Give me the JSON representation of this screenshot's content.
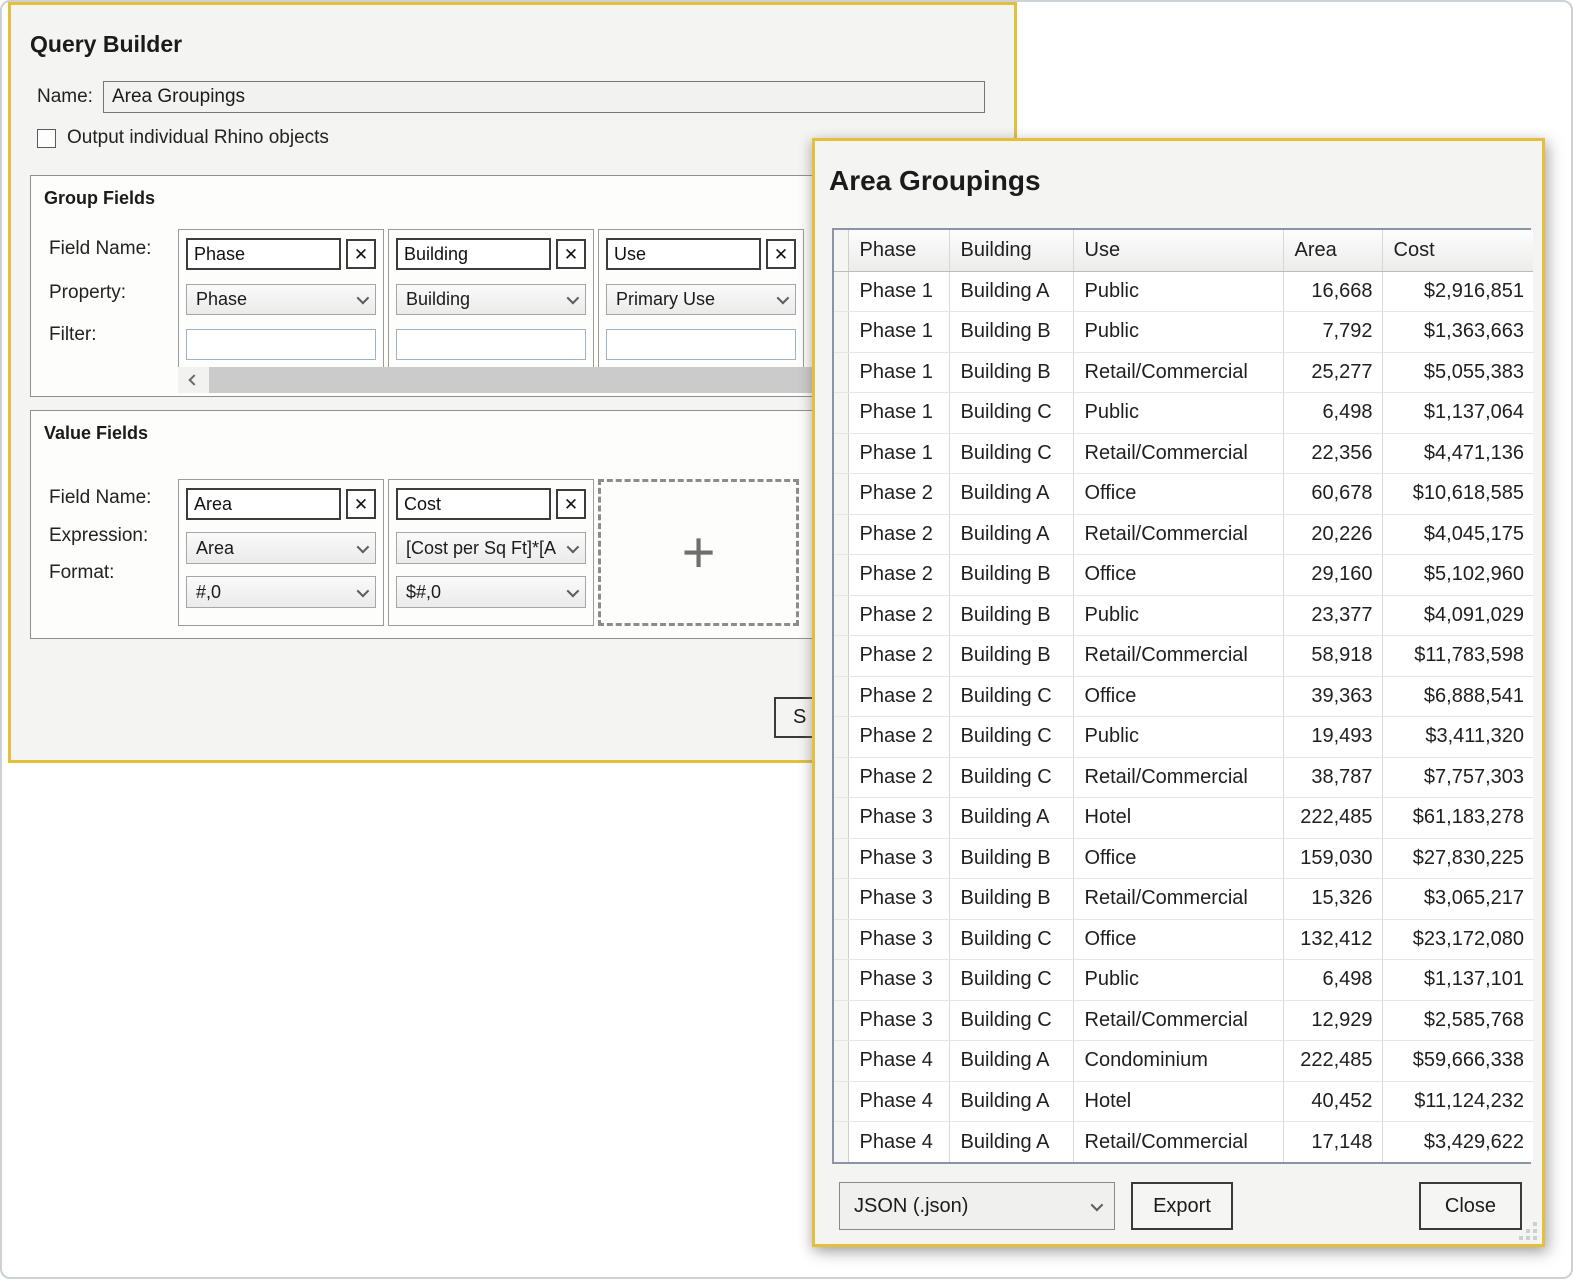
{
  "colors": {
    "window_border": "#e4bf39",
    "window_bg": "#f4f4f2",
    "table_outer_border": "#8696a5"
  },
  "icons": {
    "remove_field": "✕",
    "add_field": "+",
    "chevron_down": "⌄",
    "chevron_left": "‹",
    "resize_grip": "⋰"
  },
  "query_builder": {
    "title": "Query Builder",
    "name_label": "Name:",
    "name_value": "Area Groupings",
    "checkbox_label": "Output individual Rhino objects",
    "checkbox_checked": false,
    "group_fields": {
      "title": "Group Fields",
      "row_labels": [
        "Field Name:",
        "Property:",
        "Filter:"
      ],
      "fields": [
        {
          "name": "Phase",
          "property": "Phase",
          "filter": ""
        },
        {
          "name": "Building",
          "property": "Building",
          "filter": ""
        },
        {
          "name": "Use",
          "property": "Primary Use",
          "filter": ""
        }
      ]
    },
    "value_fields": {
      "title": "Value Fields",
      "row_labels": [
        "Field Name:",
        "Expression:",
        "Format:"
      ],
      "fields": [
        {
          "name": "Area",
          "expression": "Area",
          "format": "#,0"
        },
        {
          "name": "Cost",
          "expression": "[Cost per Sq Ft]*[A",
          "format": "$#,0"
        }
      ]
    },
    "partial_button_label": "S"
  },
  "results_window": {
    "title": "Area Groupings",
    "table": {
      "columns": [
        "Phase",
        "Building",
        "Use",
        "Area",
        "Cost"
      ],
      "rows": [
        [
          "Phase 1",
          "Building A",
          "Public",
          "16,668",
          "$2,916,851"
        ],
        [
          "Phase 1",
          "Building B",
          "Public",
          "7,792",
          "$1,363,663"
        ],
        [
          "Phase 1",
          "Building B",
          "Retail/Commercial",
          "25,277",
          "$5,055,383"
        ],
        [
          "Phase 1",
          "Building C",
          "Public",
          "6,498",
          "$1,137,064"
        ],
        [
          "Phase 1",
          "Building C",
          "Retail/Commercial",
          "22,356",
          "$4,471,136"
        ],
        [
          "Phase 2",
          "Building A",
          "Office",
          "60,678",
          "$10,618,585"
        ],
        [
          "Phase 2",
          "Building A",
          "Retail/Commercial",
          "20,226",
          "$4,045,175"
        ],
        [
          "Phase 2",
          "Building B",
          "Office",
          "29,160",
          "$5,102,960"
        ],
        [
          "Phase 2",
          "Building B",
          "Public",
          "23,377",
          "$4,091,029"
        ],
        [
          "Phase 2",
          "Building B",
          "Retail/Commercial",
          "58,918",
          "$11,783,598"
        ],
        [
          "Phase 2",
          "Building C",
          "Office",
          "39,363",
          "$6,888,541"
        ],
        [
          "Phase 2",
          "Building C",
          "Public",
          "19,493",
          "$3,411,320"
        ],
        [
          "Phase 2",
          "Building C",
          "Retail/Commercial",
          "38,787",
          "$7,757,303"
        ],
        [
          "Phase 3",
          "Building A",
          "Hotel",
          "222,485",
          "$61,183,278"
        ],
        [
          "Phase 3",
          "Building B",
          "Office",
          "159,030",
          "$27,830,225"
        ],
        [
          "Phase 3",
          "Building B",
          "Retail/Commercial",
          "15,326",
          "$3,065,217"
        ],
        [
          "Phase 3",
          "Building C",
          "Office",
          "132,412",
          "$23,172,080"
        ],
        [
          "Phase 3",
          "Building C",
          "Public",
          "6,498",
          "$1,137,101"
        ],
        [
          "Phase 3",
          "Building C",
          "Retail/Commercial",
          "12,929",
          "$2,585,768"
        ],
        [
          "Phase 4",
          "Building A",
          "Condominium",
          "222,485",
          "$59,666,338"
        ],
        [
          "Phase 4",
          "Building A",
          "Hotel",
          "40,452",
          "$11,124,232"
        ],
        [
          "Phase 4",
          "Building A",
          "Retail/Commercial",
          "17,148",
          "$3,429,622"
        ]
      ]
    },
    "footer": {
      "format_dropdown_value": "JSON (.json)",
      "export_label": "Export",
      "close_label": "Close"
    }
  }
}
